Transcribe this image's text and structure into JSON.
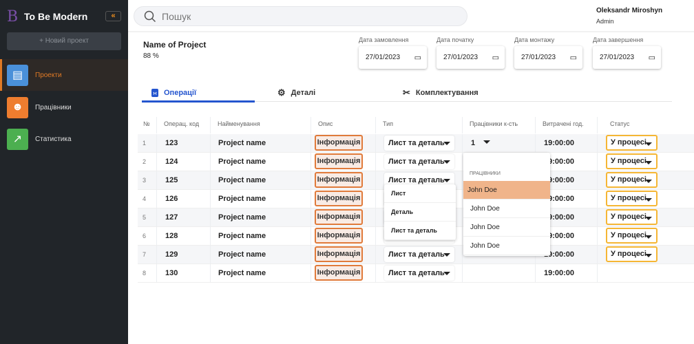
{
  "sidebar": {
    "brand": "To Be Modern",
    "logo": "B",
    "collapse_icon": "double-chevron-left-icon",
    "new_project": "+ Новий проект",
    "items": [
      {
        "label": "Проекти",
        "icon": "document-icon",
        "color": "#4a90d9",
        "active": true
      },
      {
        "label": "Працівники",
        "icon": "team-icon",
        "color": "#ee7d2f"
      },
      {
        "label": "Статистика",
        "icon": "chart-growth-icon",
        "color": "#4caf50"
      }
    ]
  },
  "header": {
    "search_placeholder": "Пошук",
    "user_name": "Oleksandr Miroshyn",
    "user_role": "Admin"
  },
  "project": {
    "name": "Name of Project",
    "percent": "88 %",
    "dates": [
      {
        "label": "Дата замовлення",
        "value": "27/01/2023"
      },
      {
        "label": "Дата початку",
        "value": "27/01/2023"
      },
      {
        "label": "Дата монтажу",
        "value": "27/01/2023"
      },
      {
        "label": "Дата завершення",
        "value": "27/01/2023"
      }
    ]
  },
  "tabs": [
    {
      "label": "Операції",
      "active": true
    },
    {
      "label": "Деталі"
    },
    {
      "label": "Комплектування"
    }
  ],
  "table": {
    "columns": [
      "№",
      "Операц. код",
      "Найменування",
      "Опис",
      "Тип",
      "Працівники к-сть",
      "Витрачені год.",
      "Статус"
    ],
    "rows": [
      {
        "n": "1",
        "code": "123",
        "name": "Project name",
        "desc": "Інформація",
        "type": "Лист та деталь",
        "workers": "1",
        "hours": "19:00:00",
        "status": "У процесі"
      },
      {
        "n": "2",
        "code": "124",
        "name": "Project name",
        "desc": "Інформація",
        "type": "Лист та деталь",
        "hours": "19:00:00",
        "status": "У процесі"
      },
      {
        "n": "3",
        "code": "125",
        "name": "Project name",
        "desc": "Інформація",
        "type": "Лист та деталь",
        "hours": "19:00:00",
        "status": "У процесі"
      },
      {
        "n": "4",
        "code": "126",
        "name": "Project name",
        "desc": "Інформація",
        "hours": "19:00:00",
        "status": "У процесі"
      },
      {
        "n": "5",
        "code": "127",
        "name": "Project name",
        "desc": "Інформація",
        "hours": "19:00:00",
        "status": "У процесі"
      },
      {
        "n": "6",
        "code": "128",
        "name": "Project name",
        "desc": "Інформація",
        "hours": "19:00:00",
        "status": "У процесі"
      },
      {
        "n": "7",
        "code": "129",
        "name": "Project name",
        "desc": "Інформація",
        "type": "Лист та деталь",
        "hours": "19:00:00",
        "status": "У процесі"
      },
      {
        "n": "8",
        "code": "130",
        "name": "Project name",
        "desc": "Інформація",
        "type": "Лист та деталь",
        "hours": "19:00:00"
      }
    ]
  },
  "type_menu": [
    "Лист",
    "Деталь",
    "Лист та деталь"
  ],
  "workers_menu": {
    "heading": "ПРАЦІВНИКИ",
    "items": [
      "John Doe",
      "John Doe",
      "John Doe",
      "John Doe"
    ],
    "highlight_color": "#f0b48a"
  }
}
